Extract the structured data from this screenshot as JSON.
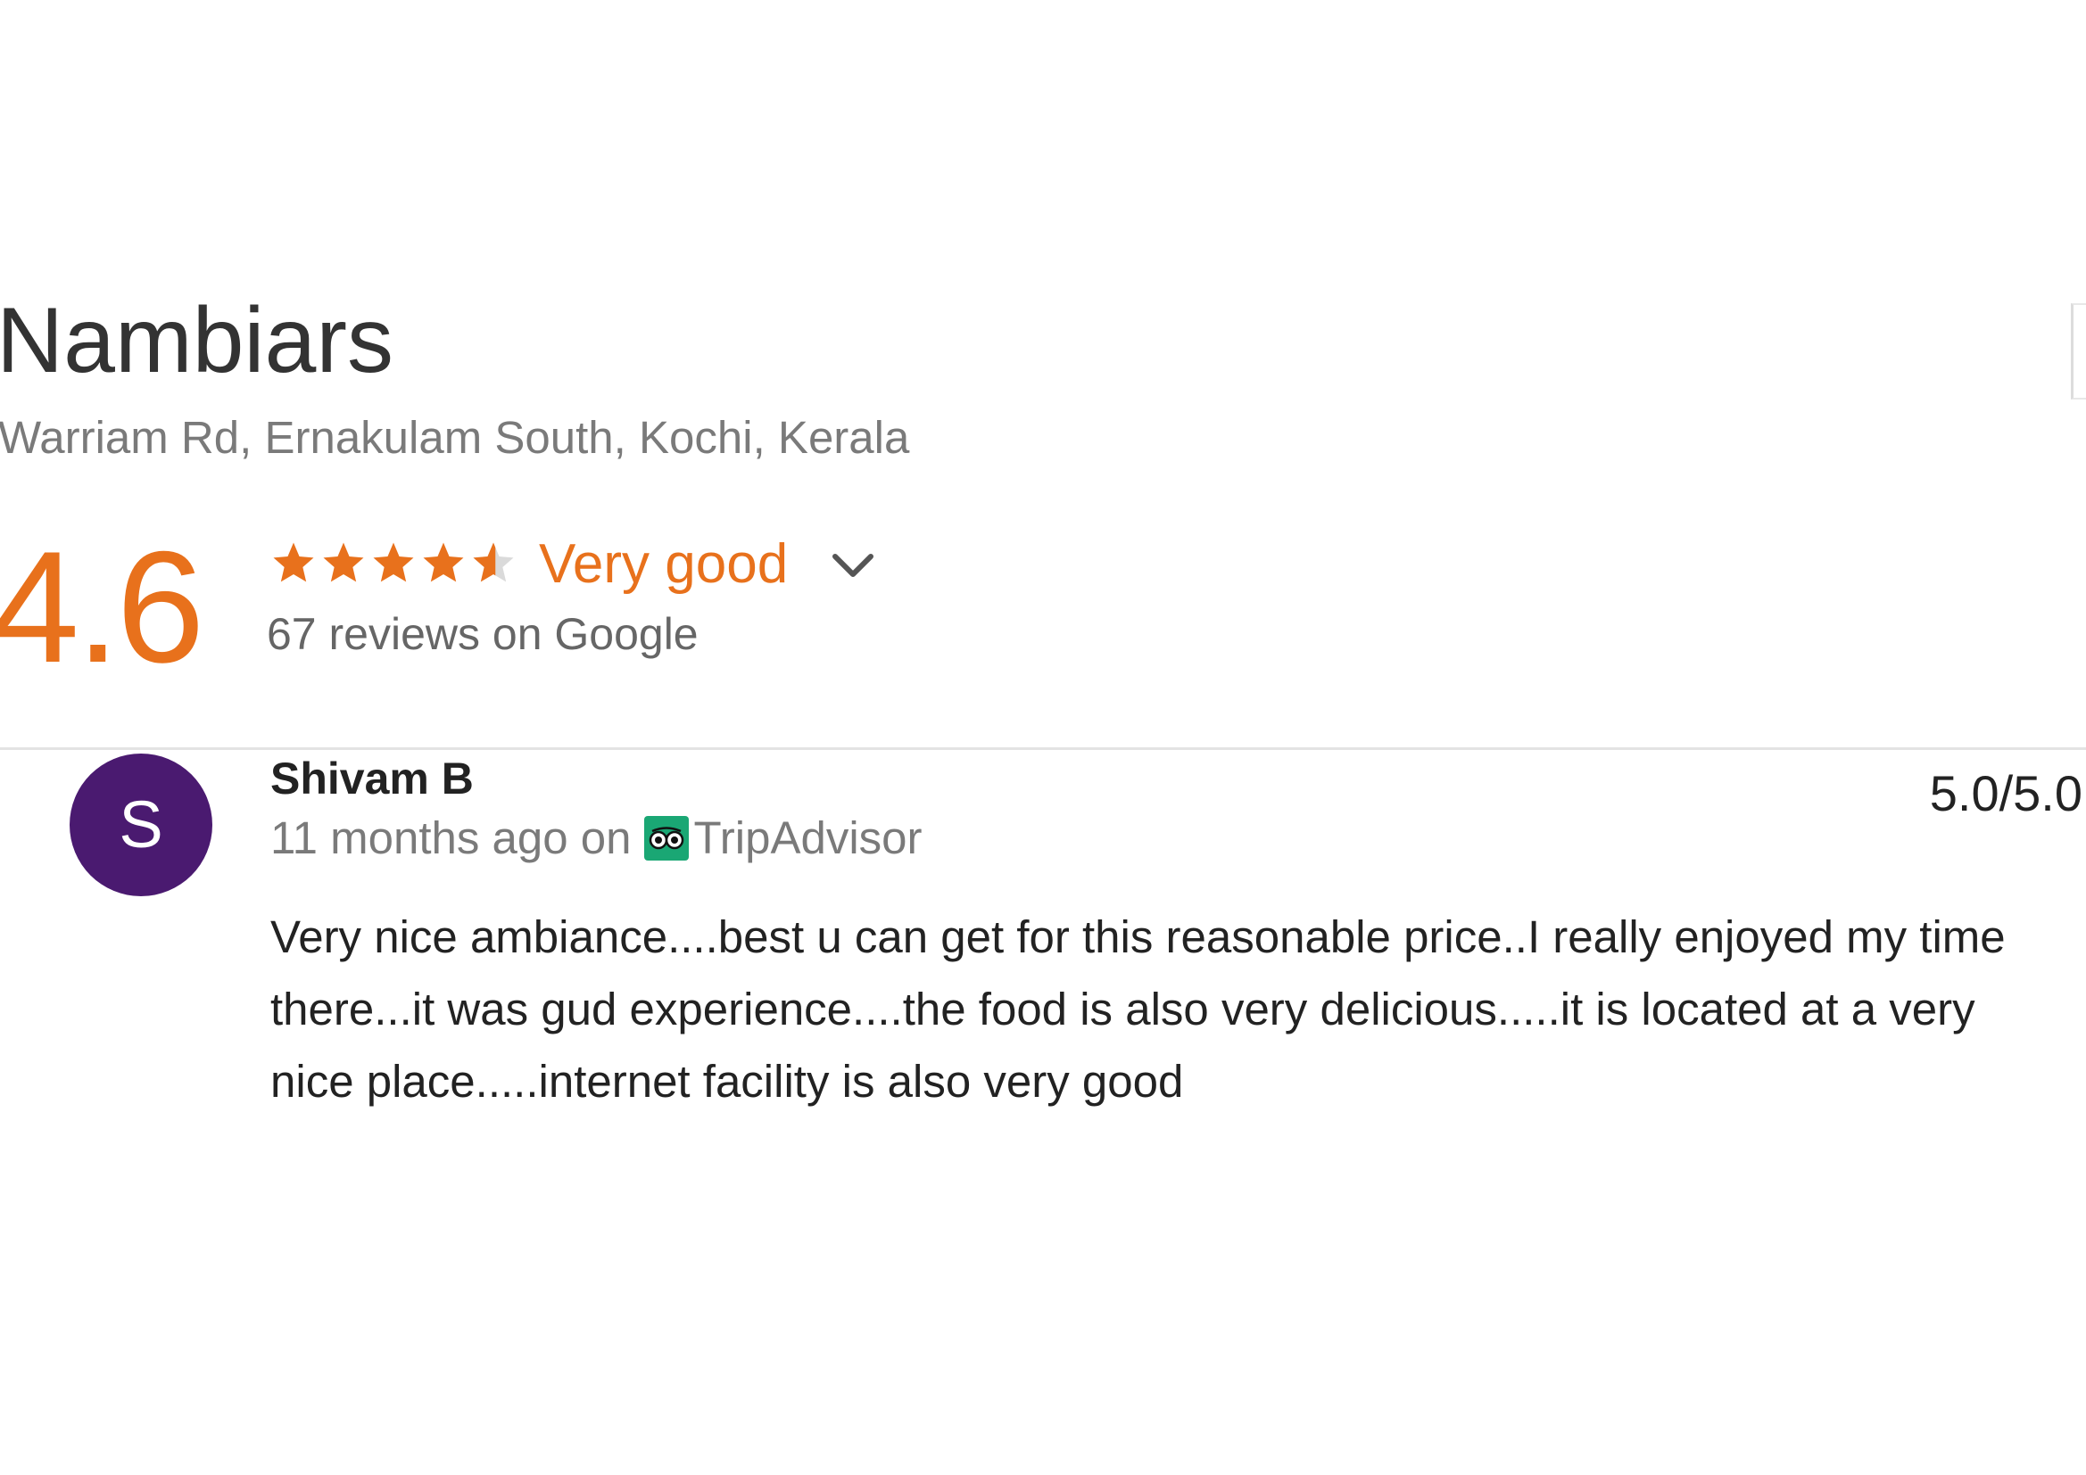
{
  "place": {
    "name": "Nambiars",
    "address": "Warriam Rd, Ernakulam South, Kochi, Kerala"
  },
  "rating": {
    "score": "4.6",
    "stars_value": 4.6,
    "stars_max": 5,
    "label": "Very good",
    "review_count_text": "67 reviews on Google",
    "accent_color": "#e8711c"
  },
  "review": {
    "avatar_letter": "S",
    "avatar_color": "#4a1a70",
    "author": "Shivam B",
    "time_ago": "11 months ago on",
    "source": "TripAdvisor",
    "source_icon": "tripadvisor-icon",
    "score": "5.0/5.0",
    "text": "Very nice ambiance....best u can get for this reasonable price..I really enjoyed my time there...it was gud experience....the food is also very delicious.....it is located at a very nice place.....internet facility is also very good"
  }
}
